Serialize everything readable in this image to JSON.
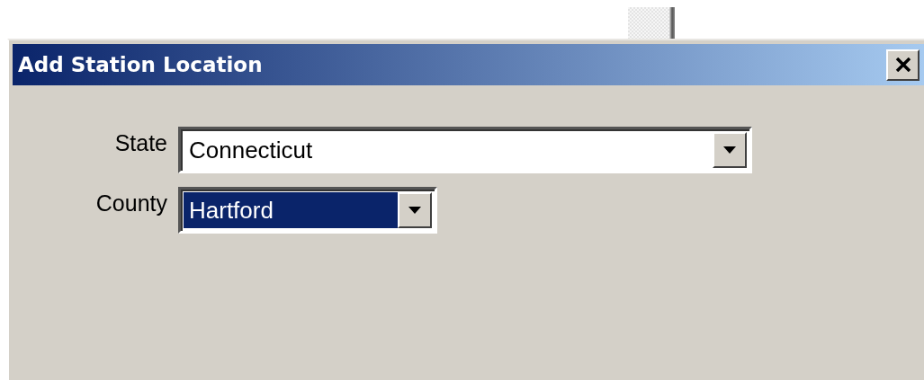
{
  "window": {
    "title": "Add Station Location"
  },
  "fields": [
    {
      "label": "State",
      "value": "Connecticut",
      "focused": false
    },
    {
      "label": "County",
      "value": "Hartford",
      "focused": true
    }
  ]
}
